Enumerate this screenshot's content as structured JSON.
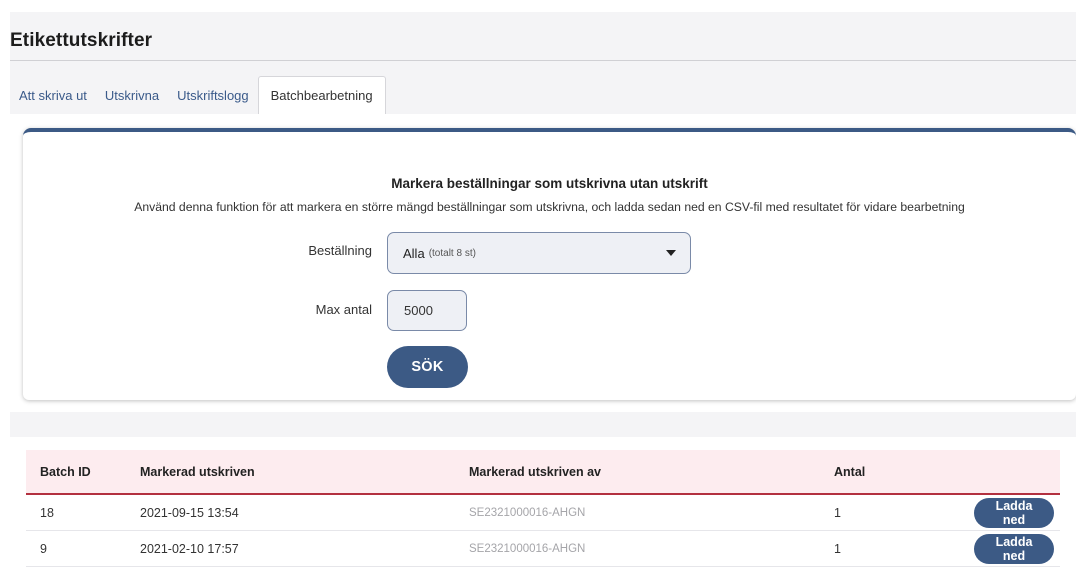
{
  "page": {
    "title": "Etikettutskrifter"
  },
  "tabs": [
    {
      "label": "Att skriva ut"
    },
    {
      "label": "Utskrivna"
    },
    {
      "label": "Utskriftslogg"
    },
    {
      "label": "Batchbearbetning"
    }
  ],
  "card": {
    "heading": "Markera beställningar som utskrivna utan utskrift",
    "description": "Använd denna funktion för att markera en större mängd beställningar som utskrivna, och ladda sedan ned en CSV-fil med resultatet för vidare bearbetning",
    "order_label": "Beställning",
    "order_value": "Alla",
    "order_hint": "(totalt 8 st)",
    "max_label": "Max antal",
    "max_value": "5000",
    "search_label": "SÖK"
  },
  "table": {
    "headers": [
      "Batch ID",
      "Markerad utskriven",
      "Markerad utskriven av",
      "Antal"
    ],
    "rows": [
      {
        "batch_id": "18",
        "marked_at": "2021-09-15 13:54",
        "marked_by": "SE2321000016-AHGN",
        "count": "1",
        "action": "Ladda ned"
      },
      {
        "batch_id": "9",
        "marked_at": "2021-02-10 17:57",
        "marked_by": "SE2321000016-AHGN",
        "count": "1",
        "action": "Ladda ned"
      }
    ]
  },
  "colors": {
    "accent": "#3c5a85",
    "header_bg": "#fdecef",
    "header_rule": "#b3303f"
  }
}
